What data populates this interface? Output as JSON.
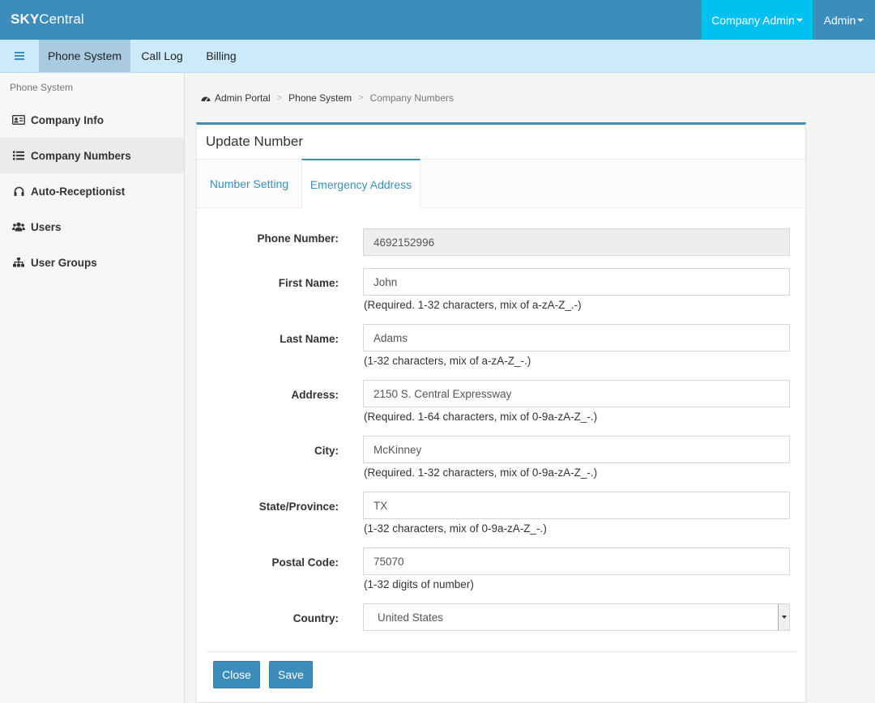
{
  "app": {
    "brand_bold": "SKY",
    "brand_light": "Central"
  },
  "topnav": {
    "company_admin": "Company Admin",
    "admin": "Admin"
  },
  "subnav": {
    "tabs": [
      "Phone System",
      "Call Log",
      "Billing"
    ]
  },
  "sidebar": {
    "header": "Phone System",
    "items": [
      {
        "label": "Company Info",
        "icon": "id-card-icon"
      },
      {
        "label": "Company Numbers",
        "icon": "list-icon"
      },
      {
        "label": "Auto-Receptionist",
        "icon": "headset-icon"
      },
      {
        "label": "Users",
        "icon": "users-icon"
      },
      {
        "label": "User Groups",
        "icon": "sitemap-icon"
      }
    ]
  },
  "breadcrumb": {
    "items": [
      "Admin Portal",
      "Phone System",
      "Company Numbers"
    ]
  },
  "panel": {
    "title": "Update Number",
    "tabs": [
      "Number Setting",
      "Emergency Address"
    ]
  },
  "form": {
    "phone_number": {
      "label": "Phone Number:",
      "value": "4692152996"
    },
    "first_name": {
      "label": "First Name:",
      "value": "John",
      "help": "(Required. 1-32 characters, mix of a-zA-Z_.-)"
    },
    "last_name": {
      "label": "Last Name:",
      "value": "Adams",
      "help": "(1-32 characters, mix of a-zA-Z_-.)"
    },
    "address": {
      "label": "Address:",
      "value": "2150 S. Central Expressway",
      "help": "(Required. 1-64 characters, mix of 0-9a-zA-Z_-.)"
    },
    "city": {
      "label": "City:",
      "value": "McKinney",
      "help": "(Required. 1-32 characters, mix of 0-9a-zA-Z_-.)"
    },
    "state": {
      "label": "State/Province:",
      "value": "TX",
      "help": "(1-32 characters, mix of 0-9a-zA-Z_-.)"
    },
    "postal": {
      "label": "Postal Code:",
      "value": "75070",
      "help": "(1-32 digits of number)"
    },
    "country": {
      "label": "Country:",
      "value": "United States"
    }
  },
  "buttons": {
    "close": "Close",
    "save": "Save"
  },
  "colors": {
    "primary": "#3c8dbc",
    "accent": "#00c0ef",
    "subnav": "#cde9fc"
  }
}
